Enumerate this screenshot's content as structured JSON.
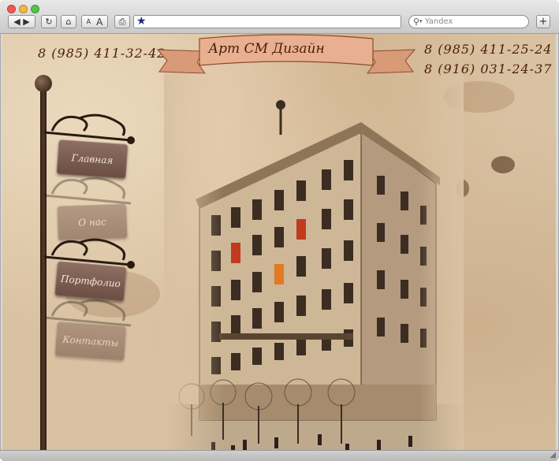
{
  "browser": {
    "search_placeholder": "Yandex",
    "font_small_label": "A",
    "font_large_label": "A",
    "new_tab_label": "+"
  },
  "site": {
    "title": "Арт СМ Дизайн",
    "phone_left": "8 (985) 411-32-42",
    "phone_right_1": "8 (985) 411-25-24",
    "phone_right_2": "8 (916) 031-24-37"
  },
  "nav": {
    "items": [
      {
        "label": "Главная",
        "active": true
      },
      {
        "label": "О нас",
        "active": false
      },
      {
        "label": "Портфолио",
        "active": true
      },
      {
        "label": "Контакты",
        "active": false
      }
    ]
  },
  "colors": {
    "paper": "#d9c2a2",
    "ink": "#4a1d0a",
    "sign": "#7a5a4e",
    "banner": "#e3a989"
  }
}
